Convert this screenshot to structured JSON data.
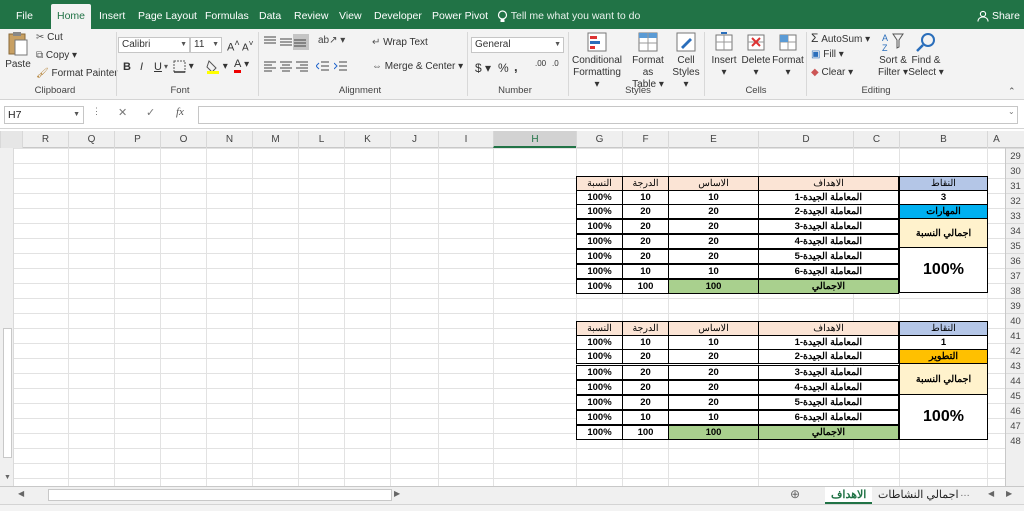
{
  "tabs": [
    "File",
    "Home",
    "Insert",
    "Page Layout",
    "Formulas",
    "Data",
    "Review",
    "View",
    "Developer",
    "Power Pivot"
  ],
  "tell_me": "Tell me what you want to do",
  "share": "Share",
  "clipboard": {
    "paste": "Paste",
    "cut": "Cut",
    "copy": "Copy",
    "format_painter": "Format Painter",
    "label": "Clipboard"
  },
  "font": {
    "name": "Calibri",
    "size": "11",
    "label": "Font",
    "bold": "B",
    "italic": "I",
    "underline": "U"
  },
  "alignment": {
    "wrap": "Wrap Text",
    "merge": "Merge & Center",
    "label": "Alignment"
  },
  "number": {
    "format": "General",
    "currency": "$",
    "percent": "%",
    "comma": ",",
    "inc": ".00",
    "label": "Number"
  },
  "styles": {
    "conditional": "Conditional",
    "formatting": "Formatting",
    "format_as": "Format as",
    "table": "Table",
    "cell": "Cell",
    "cell_styles": "Styles",
    "label": "Styles"
  },
  "cells": {
    "insert": "Insert",
    "delete": "Delete",
    "format": "Format",
    "label": "Cells"
  },
  "editing": {
    "autosum": "AutoSum",
    "fill": "Fill",
    "clear": "Clear",
    "sort": "Sort &",
    "filter": "Filter",
    "find": "Find &",
    "select": "Select",
    "label": "Editing"
  },
  "formula_bar": {
    "name_box": "H7",
    "fx": "fx",
    "value": ""
  },
  "columns": [
    "A",
    "B",
    "C",
    "D",
    "E",
    "F",
    "G",
    "H",
    "I",
    "J",
    "K",
    "L",
    "M",
    "N",
    "O",
    "P",
    "Q",
    "R"
  ],
  "rows": [
    "29",
    "30",
    "31",
    "32",
    "33",
    "34",
    "35",
    "36",
    "37",
    "38",
    "39",
    "40",
    "41",
    "42",
    "43",
    "44",
    "45",
    "46",
    "47",
    "48"
  ],
  "table1": {
    "headers": {
      "points": "النقاط",
      "goals": "الاهداف",
      "base": "الاساس",
      "grade": "الدرجة",
      "ratio": "النسبة"
    },
    "points_value": "3",
    "category": "المهارات",
    "total_ratio_label": "اجمالي النسبة",
    "total_ratio_value": "100%",
    "rows": [
      {
        "goal": "1-المعاملة الجيدة",
        "base": "10",
        "grade": "10",
        "ratio": "100%"
      },
      {
        "goal": "2-المعاملة الجيدة",
        "base": "20",
        "grade": "20",
        "ratio": "100%"
      },
      {
        "goal": "3-المعاملة الجيدة",
        "base": "20",
        "grade": "20",
        "ratio": "100%"
      },
      {
        "goal": "4-المعاملة الجيدة",
        "base": "20",
        "grade": "20",
        "ratio": "100%"
      },
      {
        "goal": "5-المعاملة الجيدة",
        "base": "20",
        "grade": "20",
        "ratio": "100%"
      },
      {
        "goal": "6-المعاملة الجيدة",
        "base": "10",
        "grade": "10",
        "ratio": "100%"
      }
    ],
    "total": {
      "label": "الاجمالي",
      "base": "100",
      "grade": "100",
      "ratio": "100%"
    }
  },
  "table2": {
    "headers": {
      "points": "النقاط",
      "goals": "الاهداف",
      "base": "الاساس",
      "grade": "الدرجة",
      "ratio": "النسبة"
    },
    "points_value": "1",
    "category": "التطوير",
    "total_ratio_label": "اجمالي النسبة",
    "total_ratio_value": "100%",
    "rows": [
      {
        "goal": "1-المعاملة الجيدة",
        "base": "10",
        "grade": "10",
        "ratio": "100%"
      },
      {
        "goal": "2-المعاملة الجيدة",
        "base": "20",
        "grade": "20",
        "ratio": "100%"
      },
      {
        "goal": "3-المعاملة الجيدة",
        "base": "20",
        "grade": "20",
        "ratio": "100%"
      },
      {
        "goal": "4-المعاملة الجيدة",
        "base": "20",
        "grade": "20",
        "ratio": "100%"
      },
      {
        "goal": "5-المعاملة الجيدة",
        "base": "20",
        "grade": "20",
        "ratio": "100%"
      },
      {
        "goal": "6-المعاملة الجيدة",
        "base": "10",
        "grade": "10",
        "ratio": "100%"
      }
    ],
    "total": {
      "label": "الاجمالي",
      "base": "100",
      "grade": "100",
      "ratio": "100%"
    }
  },
  "sheets": [
    "اجمالي النشاطات",
    "الاهداف"
  ],
  "colors": {
    "accent": "#217346",
    "header_fill": "#fbe4d5",
    "total_fill": "#a9d08e",
    "points_fill": "#b4c6e7",
    "skills_fill": "#00b0f0",
    "dev_fill": "#ffc000",
    "ratio_fill": "#fff2cc"
  }
}
